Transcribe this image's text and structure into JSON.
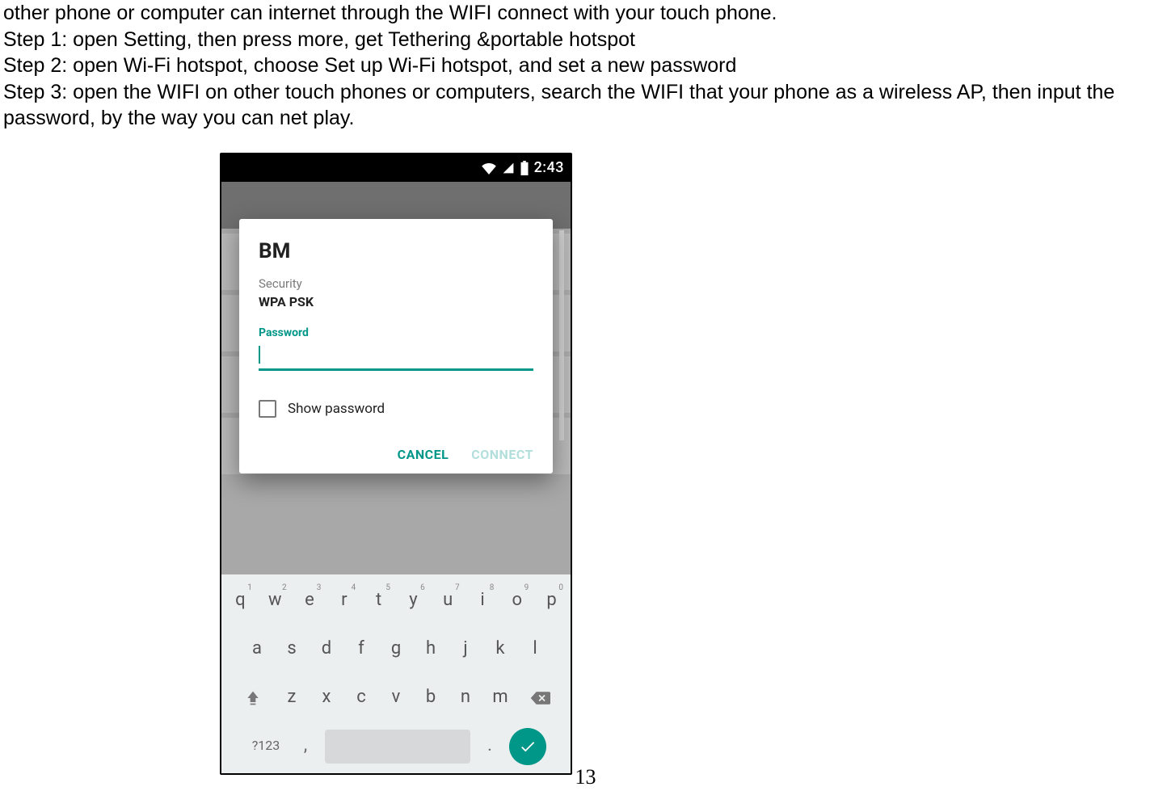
{
  "doc": {
    "line0": "other phone or computer can internet through the WIFI connect with your touch phone.",
    "line1": "Step 1: open Setting, then press more, get Tethering &portable hotspot",
    "line2": "Step 2: open Wi-Fi hotspot, choose Set up Wi-Fi hotspot, and set a new password",
    "line3": "Step 3: open the WIFI on other touch phones or computers, search the WIFI that your phone as a wireless AP, then input the password, by the way you can net play.",
    "page_number": "13"
  },
  "status": {
    "time": "2:43"
  },
  "dialog": {
    "title": "BM",
    "security_label": "Security",
    "security_value": "WPA PSK",
    "password_label": "Password",
    "show_password": "Show password",
    "cancel": "CANCEL",
    "connect": "CONNECT"
  },
  "keyboard": {
    "row1": [
      {
        "k": "q",
        "n": "1"
      },
      {
        "k": "w",
        "n": "2"
      },
      {
        "k": "e",
        "n": "3"
      },
      {
        "k": "r",
        "n": "4"
      },
      {
        "k": "t",
        "n": "5"
      },
      {
        "k": "y",
        "n": "6"
      },
      {
        "k": "u",
        "n": "7"
      },
      {
        "k": "i",
        "n": "8"
      },
      {
        "k": "o",
        "n": "9"
      },
      {
        "k": "p",
        "n": "0"
      }
    ],
    "row2": [
      "a",
      "s",
      "d",
      "f",
      "g",
      "h",
      "j",
      "k",
      "l"
    ],
    "row3": [
      "z",
      "x",
      "c",
      "v",
      "b",
      "n",
      "m"
    ],
    "sym": "?123",
    "comma": ",",
    "dot": "."
  }
}
